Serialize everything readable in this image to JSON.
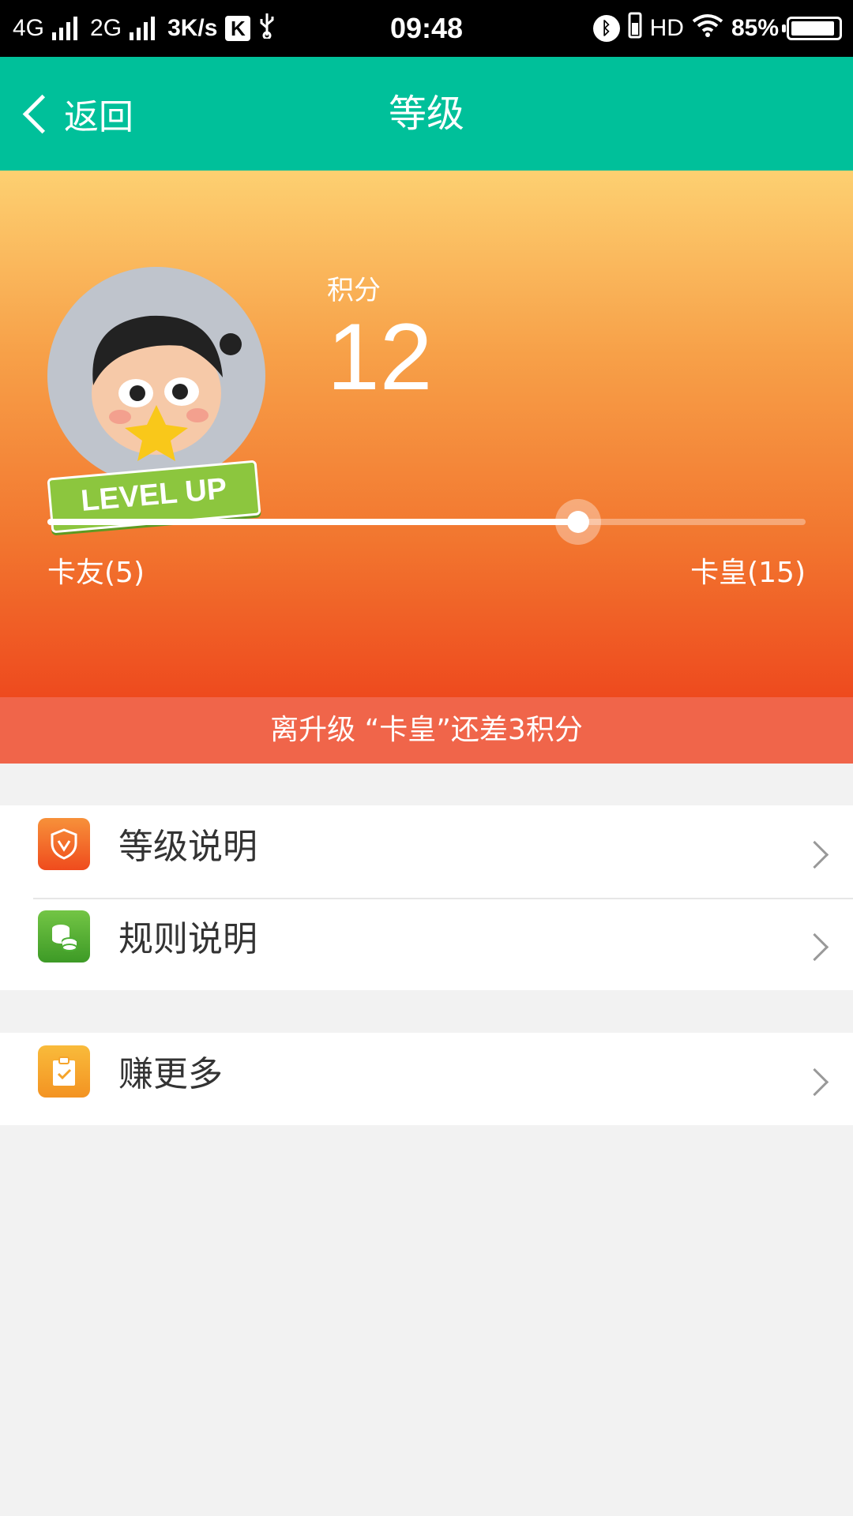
{
  "status_bar": {
    "net1": "4G",
    "net2": "2G",
    "speed": "3K/s",
    "k_badge": "K",
    "time": "09:48",
    "hd": "HD",
    "battery_text": "85%",
    "battery_level": 0.85
  },
  "nav": {
    "back_label": "返回",
    "title": "等级"
  },
  "level": {
    "score_label": "积分",
    "score_value": "12",
    "badge_text": "LEVEL UP",
    "current_level": "卡友(5)",
    "next_level": "卡皇(15)",
    "progress": 0.7,
    "notice": "离升级 “卡皇”还差3积分"
  },
  "menu_group1": [
    {
      "label": "等级说明",
      "icon": "shield-icon",
      "color": "#f05a22"
    },
    {
      "label": "规则说明",
      "icon": "coins-icon",
      "color": "#4caf34"
    }
  ],
  "menu_group2": [
    {
      "label": "赚更多",
      "icon": "clipboard-check-icon",
      "color": "#f5a42a"
    }
  ],
  "colors": {
    "nav": "#00c09a",
    "notice": "#f0654a"
  }
}
